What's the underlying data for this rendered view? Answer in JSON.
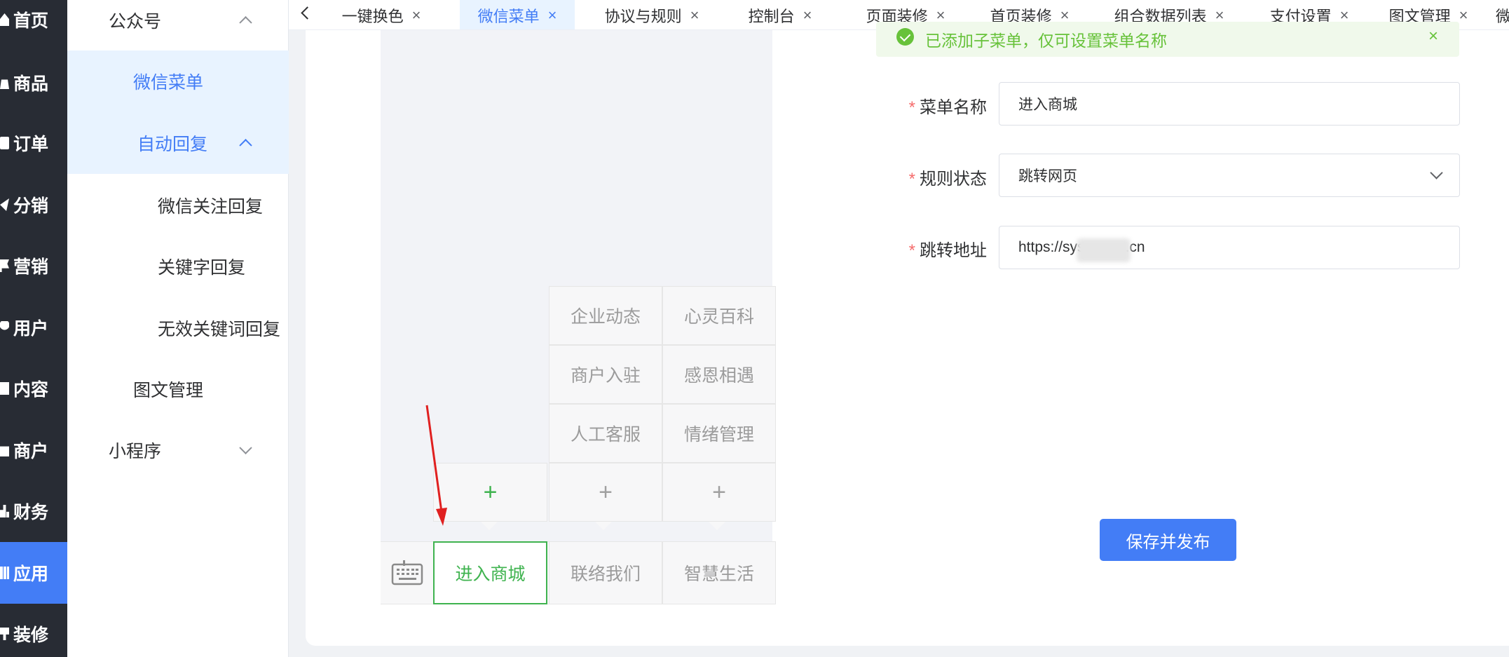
{
  "left_nav": {
    "items": [
      {
        "label": "首页",
        "icon": "home-icon"
      },
      {
        "label": "商品",
        "icon": "bag-icon"
      },
      {
        "label": "订单",
        "icon": "order-icon"
      },
      {
        "label": "分销",
        "icon": "send-icon"
      },
      {
        "label": "营销",
        "icon": "flag-icon"
      },
      {
        "label": "用户",
        "icon": "user-icon"
      },
      {
        "label": "内容",
        "icon": "book-icon"
      },
      {
        "label": "商户",
        "icon": "shop-icon"
      },
      {
        "label": "财务",
        "icon": "chart-icon"
      },
      {
        "label": "应用",
        "icon": "grid-icon",
        "active": true
      },
      {
        "label": "装修",
        "icon": "brush-icon"
      }
    ]
  },
  "submenu": {
    "gzh": "公众号",
    "wechat_menu": "微信菜单",
    "auto_reply": "自动回复",
    "follow_reply": "微信关注回复",
    "keyword_reply": "关键字回复",
    "invalid_keyword_reply": "无效关键词回复",
    "article_mgmt": "图文管理",
    "mini_program": "小程序"
  },
  "tabs": [
    {
      "label": "一键换色"
    },
    {
      "label": "微信菜单",
      "active": true
    },
    {
      "label": "协议与规则"
    },
    {
      "label": "控制台"
    },
    {
      "label": "页面装修"
    },
    {
      "label": "首页装修"
    },
    {
      "label": "组合数据列表"
    },
    {
      "label": "支付设置"
    },
    {
      "label": "图文管理"
    },
    {
      "label": "微"
    }
  ],
  "phone": {
    "submenu_col2": [
      "企业动态",
      "商户入驻",
      "人工客服"
    ],
    "submenu_col3": [
      "心灵百科",
      "感恩相遇",
      "情绪管理"
    ],
    "plus": "+",
    "main_menu": [
      "进入商城",
      "联络我们",
      "智慧生活"
    ]
  },
  "form": {
    "alert_text": "已添加子菜单，仅可设置菜单名称",
    "alert_close": "×",
    "required_mark": "*",
    "name_label": "菜单名称",
    "name_value": "进入商城",
    "rule_label": "规则状态",
    "rule_value": "跳转网页",
    "url_label": "跳转地址",
    "url_value_prefix": "https://sys",
    "url_value_suffix": ".cn",
    "save_label": "保存并发布"
  },
  "colors": {
    "accent": "#437df6",
    "green": "#3fb34f",
    "sidebar_dark": "#282c34",
    "required": "#f56c6c"
  }
}
